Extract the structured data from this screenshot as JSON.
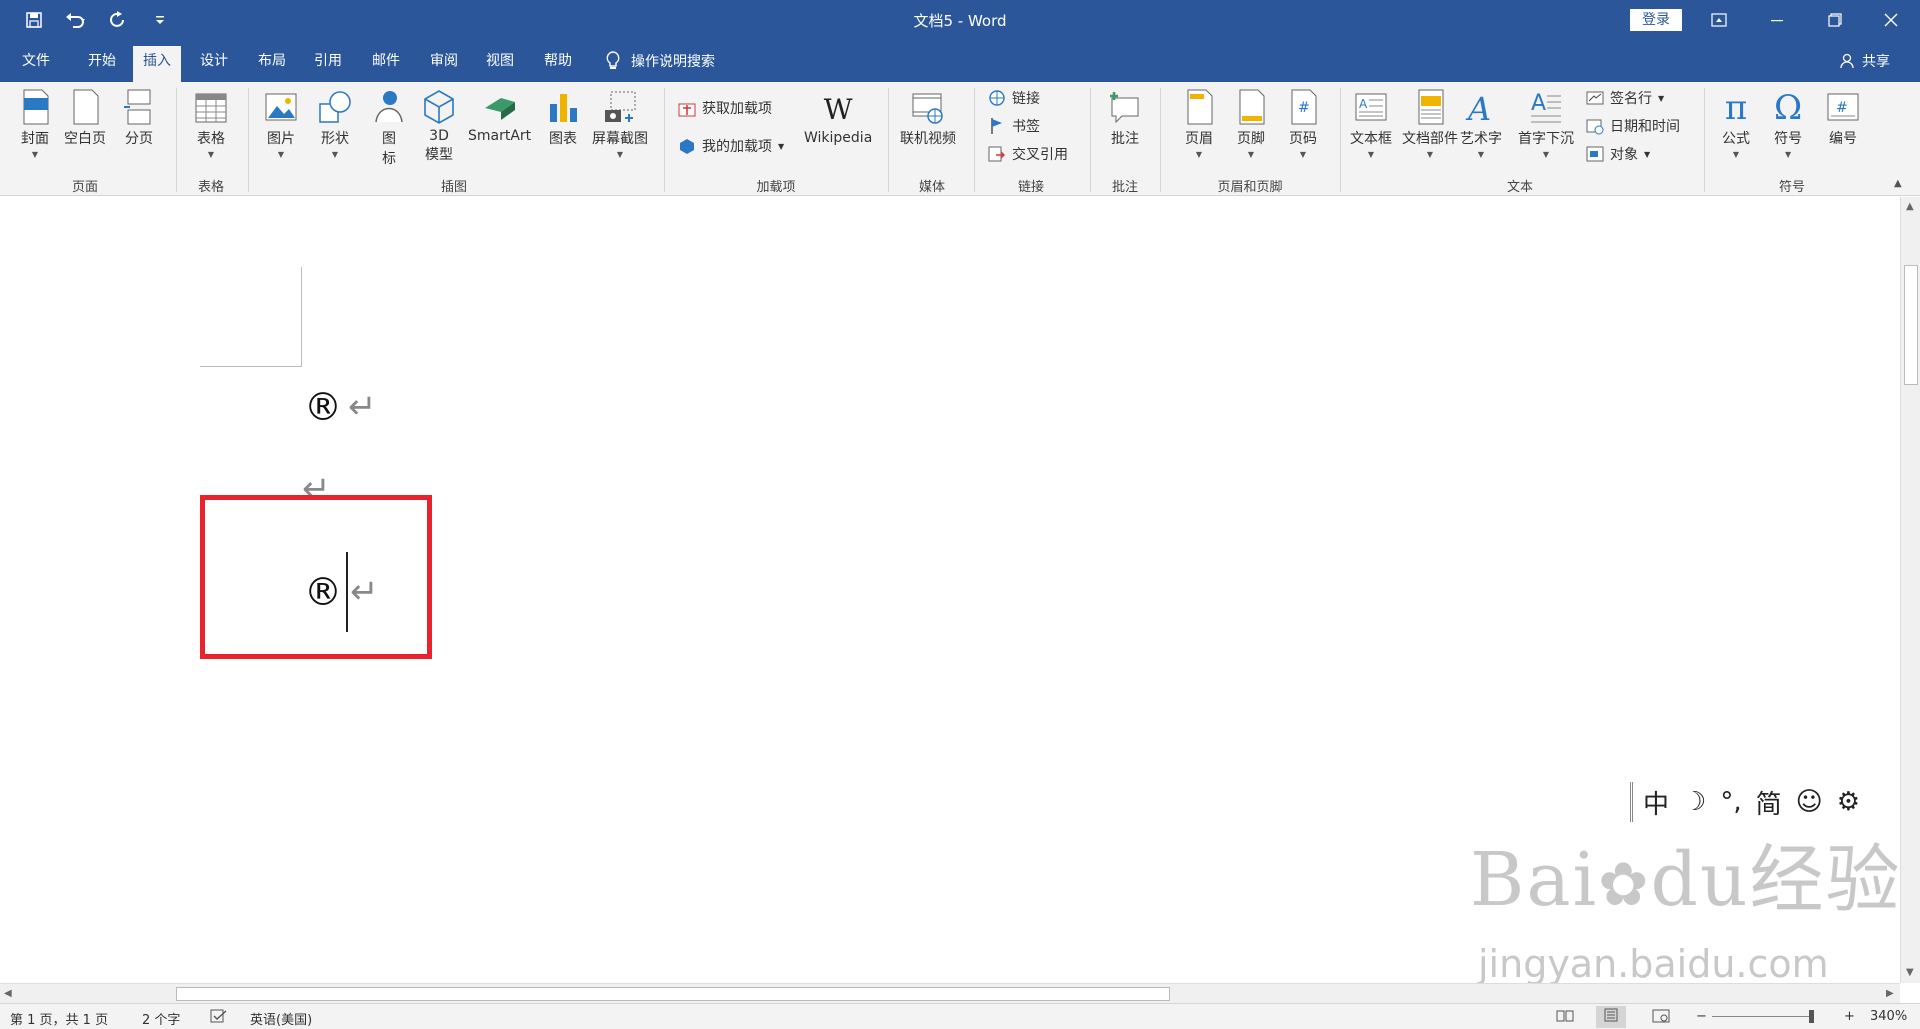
{
  "window": {
    "title": "文档5  -  Word",
    "login_label": "登录"
  },
  "menu": {
    "tabs": [
      "文件",
      "开始",
      "插入",
      "设计",
      "布局",
      "引用",
      "邮件",
      "审阅",
      "视图",
      "帮助"
    ],
    "active_tab": "插入",
    "tell_me": "操作说明搜索",
    "share": "共享"
  },
  "ribbon": {
    "pages": {
      "cover": "封面",
      "blank": "空白页",
      "break": "分页",
      "group": "页面"
    },
    "tables": {
      "table": "表格",
      "group": "表格"
    },
    "illustrations": {
      "picture": "图片",
      "shapes": "形状",
      "icons_line1": "图",
      "icons_line2": "标",
      "model_line1": "3D",
      "model_line2": "模型",
      "smartart": "SmartArt",
      "chart": "图表",
      "screenshot": "屏幕截图",
      "group": "插图"
    },
    "addins": {
      "get": "获取加载项",
      "my": "我的加载项",
      "wikipedia": "Wikipedia",
      "group": "加载项"
    },
    "media": {
      "video": "联机视频",
      "group": "媒体"
    },
    "links": {
      "link": "链接",
      "bookmark": "书签",
      "crossref": "交叉引用",
      "group": "链接"
    },
    "comments": {
      "comment": "批注",
      "group": "批注"
    },
    "header_footer": {
      "header": "页眉",
      "footer": "页脚",
      "page_number": "页码",
      "group": "页眉和页脚"
    },
    "text": {
      "textbox": "文本框",
      "quickparts": "文档部件",
      "wordart": "艺术字",
      "dropcap": "首字下沉",
      "signature": "签名行",
      "datetime": "日期和时间",
      "object": "对象",
      "group": "文本"
    },
    "symbols": {
      "equation": "公式",
      "symbol": "符号",
      "number": "编号",
      "group": "符号"
    }
  },
  "document": {
    "line1": "®",
    "line3": "®",
    "para_mark": "↵"
  },
  "ime": {
    "mode": "中",
    "moon": "☽",
    "punct": "°,",
    "simp": "简",
    "emoji": "☺",
    "gear": "⚙"
  },
  "watermark": {
    "brand": "Bai",
    "brand2": "du",
    "cn": "经验",
    "url": "jingyan.baidu.com"
  },
  "status": {
    "page": "第 1 页，共 1 页",
    "words": "2 个字",
    "language": "英语(美国)",
    "zoom": "340%"
  }
}
